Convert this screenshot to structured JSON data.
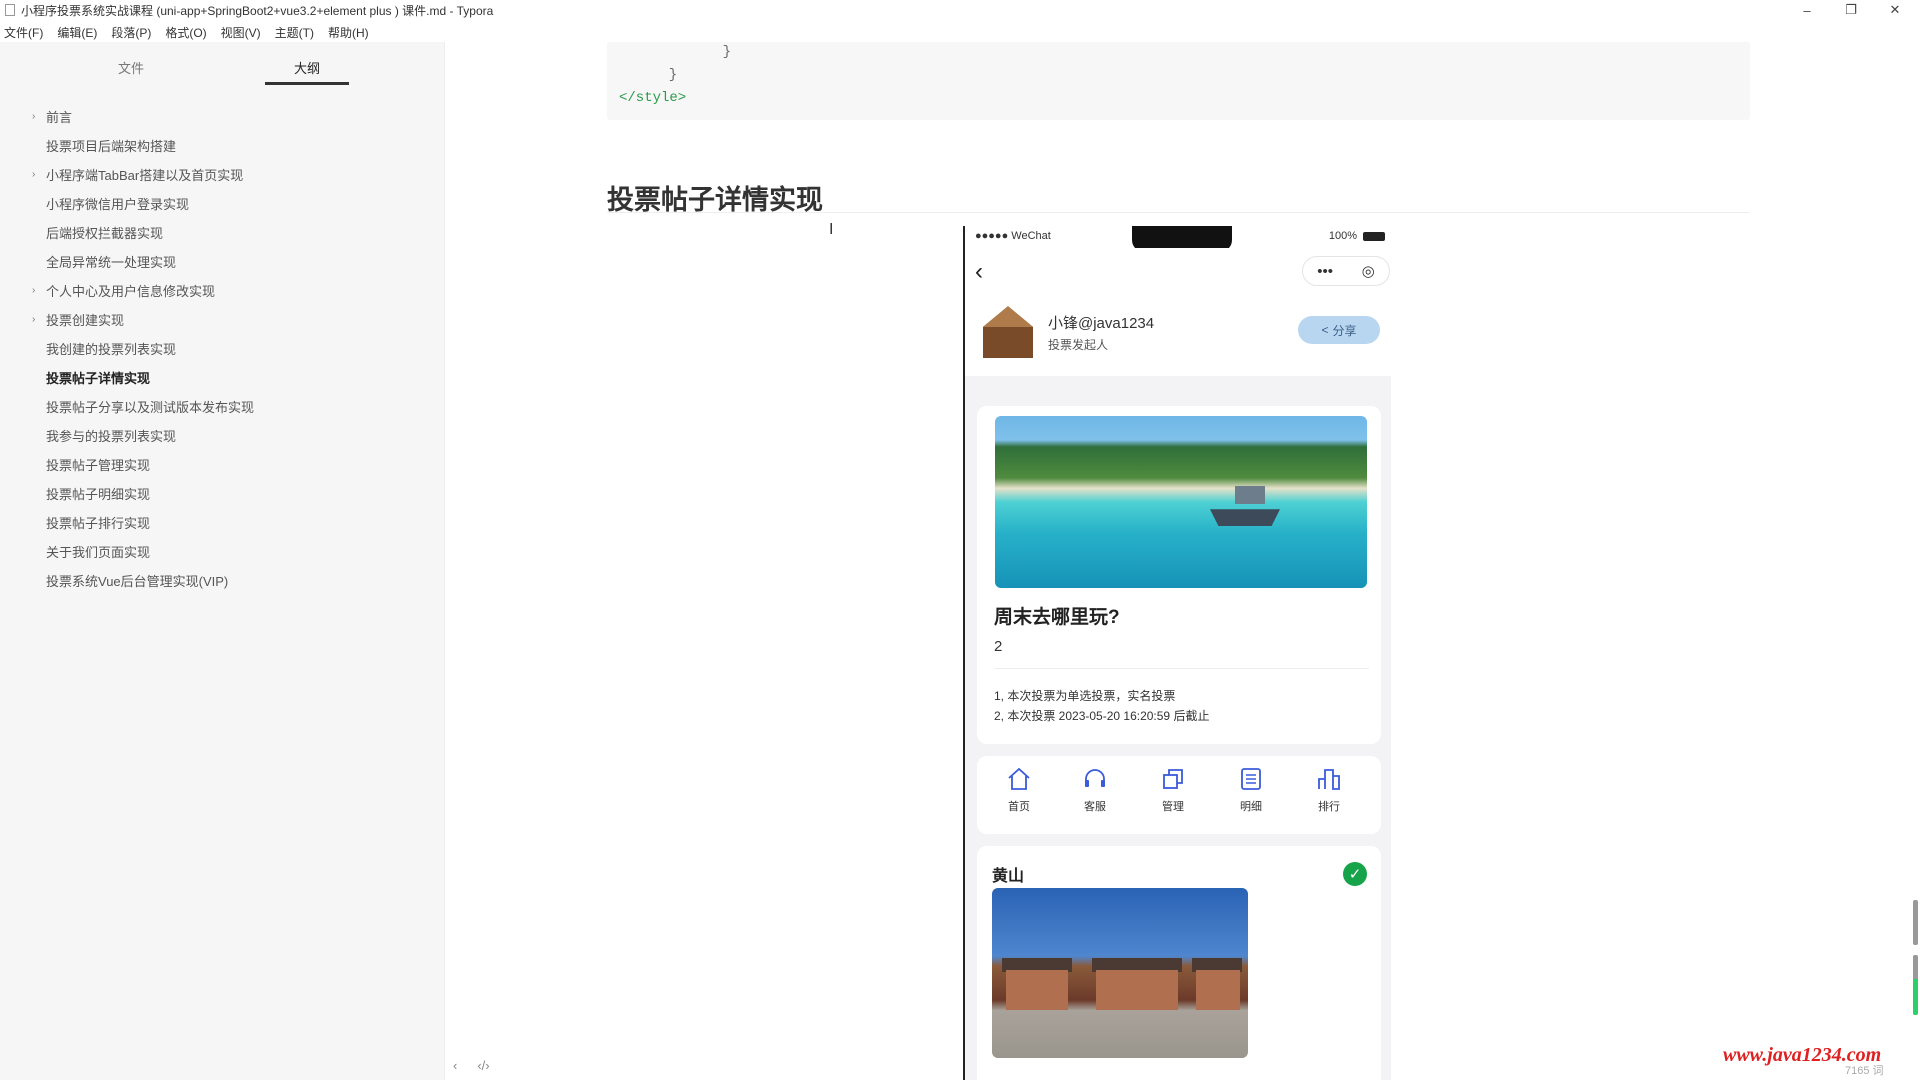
{
  "window": {
    "title": "小程序投票系统实战课程 (uni-app+SpringBoot2+vue3.2+element plus ) 课件.md - Typora",
    "controls": {
      "minimize": "–",
      "restore": "❐",
      "close": "✕"
    }
  },
  "menu": [
    "文件(F)",
    "编辑(E)",
    "段落(P)",
    "格式(O)",
    "视图(V)",
    "主题(T)",
    "帮助(H)"
  ],
  "sidebar": {
    "tabs": [
      "文件",
      "大纲"
    ],
    "active_tab": "大纲",
    "outline": [
      {
        "label": "前言",
        "expandable": true
      },
      {
        "label": "投票项目后端架构搭建",
        "expandable": false
      },
      {
        "label": "小程序端TabBar搭建以及首页实现",
        "expandable": true
      },
      {
        "label": "小程序微信用户登录实现",
        "expandable": false
      },
      {
        "label": "后端授权拦截器实现",
        "expandable": false
      },
      {
        "label": "全局异常统一处理实现",
        "expandable": false
      },
      {
        "label": "个人中心及用户信息修改实现",
        "expandable": true
      },
      {
        "label": "投票创建实现",
        "expandable": true
      },
      {
        "label": "我创建的投票列表实现",
        "expandable": false
      },
      {
        "label": "投票帖子详情实现",
        "expandable": false,
        "active": true
      },
      {
        "label": "投票帖子分享以及测试版本发布实现",
        "expandable": false
      },
      {
        "label": "我参与的投票列表实现",
        "expandable": false
      },
      {
        "label": "投票帖子管理实现",
        "expandable": false
      },
      {
        "label": "投票帖子明细实现",
        "expandable": false
      },
      {
        "label": "投票帖子排行实现",
        "expandable": false
      },
      {
        "label": "关于我们页面实现",
        "expandable": false
      },
      {
        "label": "投票系统Vue后台管理实现(VIP)",
        "expandable": false
      }
    ],
    "bottom_icons": [
      "‹",
      "‹/›"
    ]
  },
  "editor": {
    "code_lines": [
      "    }",
      "  }",
      "</style>"
    ],
    "heading": "投票帖子详情实现"
  },
  "phone": {
    "status_left": "●●●●● WeChat",
    "status_battery_text": "100%",
    "back_icon": "‹",
    "capsule": {
      "more": "•••",
      "close": "◎"
    },
    "author_name": "小锋@java1234",
    "author_role": "投票发起人",
    "share_label": "分享",
    "post_title": "周末去哪里玩?",
    "vote_count": "2",
    "rules": [
      "1, 本次投票为单选投票，实名投票",
      "2, 本次投票 2023-05-20 16:20:59 后截止"
    ],
    "toolbar": [
      {
        "label": "首页",
        "icon": "home-icon"
      },
      {
        "label": "客服",
        "icon": "headset-icon"
      },
      {
        "label": "管理",
        "icon": "manage-icon"
      },
      {
        "label": "明细",
        "icon": "list-icon"
      },
      {
        "label": "排行",
        "icon": "ranking-icon"
      }
    ],
    "option_name": "黄山",
    "accent": "#16a34a"
  },
  "watermark": "www.java1234.com",
  "word_count": "7165 词"
}
